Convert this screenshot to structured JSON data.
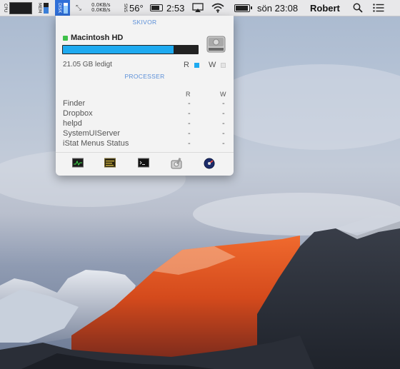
{
  "menubar": {
    "cpu_label": "CPU",
    "mem_label": "MEM",
    "disk_label": "DISK",
    "net_up": "0.0KB/s",
    "net_down": "0.0KB/s",
    "sensors_label": "SNS",
    "temperature": "56°",
    "battery_time": "2:53",
    "clock": "sön 23:08",
    "user": "Robert",
    "icons": [
      "airplay-icon",
      "wifi-icon",
      "battery-icon",
      "search-icon",
      "list-icon"
    ]
  },
  "panel": {
    "disks_header": "SKIVOR",
    "disk_name": "Macintosh HD",
    "disk_used_fraction": 0.82,
    "disk_free": "21.05 GB ledigt",
    "read_label": "R",
    "write_label": "W",
    "processes_header": "PROCESSER",
    "col_r": "R",
    "col_w": "W",
    "processes": [
      {
        "name": "Finder",
        "r": "-",
        "w": "-"
      },
      {
        "name": "Dropbox",
        "r": "-",
        "w": "-"
      },
      {
        "name": "helpd",
        "r": "-",
        "w": "-"
      },
      {
        "name": "SystemUIServer",
        "r": "-",
        "w": "-"
      },
      {
        "name": "iStat Menus Status",
        "r": "-",
        "w": "-"
      }
    ],
    "footer_icons": [
      "activity-monitor-icon",
      "console-icon",
      "terminal-icon",
      "disk-utility-icon",
      "istat-icon"
    ]
  },
  "colors": {
    "accent": "#5b8fd8",
    "disk_bar": "#1eaaf0",
    "status_green": "#3fc04a",
    "read_active": "#1eaaf0"
  }
}
